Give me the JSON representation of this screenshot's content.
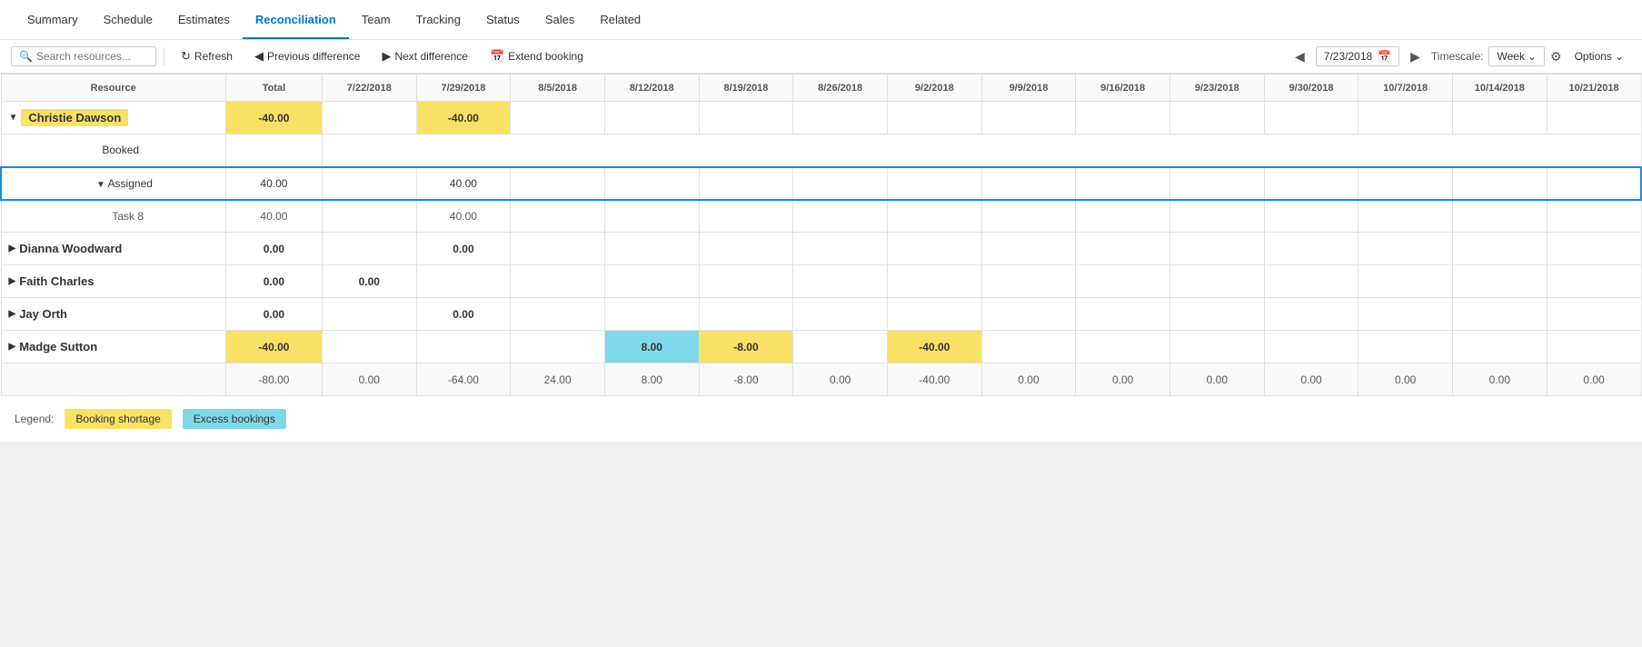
{
  "nav": {
    "items": [
      "Summary",
      "Schedule",
      "Estimates",
      "Reconciliation",
      "Team",
      "Tracking",
      "Status",
      "Sales",
      "Related"
    ],
    "active": "Reconciliation"
  },
  "toolbar": {
    "search_placeholder": "Search resources...",
    "refresh_label": "Refresh",
    "prev_diff_label": "Previous difference",
    "next_diff_label": "Next difference",
    "extend_booking_label": "Extend booking",
    "date_value": "7/23/2018",
    "timescale_label": "Timescale:",
    "timescale_value": "Week",
    "options_label": "Options"
  },
  "grid": {
    "headers": {
      "resource": "Resource",
      "total": "Total",
      "dates": [
        "7/22/2018",
        "7/29/2018",
        "8/5/2018",
        "8/12/2018",
        "8/19/2018",
        "8/26/2018",
        "9/2/2018",
        "9/9/2018",
        "9/16/2018",
        "9/23/2018",
        "9/30/2018",
        "10/7/2018",
        "10/14/2018",
        "10/21/2018"
      ]
    },
    "rows": [
      {
        "type": "resource",
        "name": "Christie Dawson",
        "highlight": true,
        "total": "-40.00",
        "cells": [
          "",
          "-40.00",
          "",
          "",
          "",
          "",
          "",
          "",
          "",
          "",
          "",
          "",
          "",
          ""
        ],
        "total_highlight": true,
        "cell_highlights": [
          false,
          true,
          false,
          false,
          false,
          false,
          false,
          false,
          false,
          false,
          false,
          false,
          false,
          false
        ]
      },
      {
        "type": "booked",
        "name": "Booked",
        "total": "",
        "cells": [
          "",
          "",
          "",
          "",
          "",
          "",
          "",
          "",
          "",
          "",
          "",
          "",
          "",
          ""
        ]
      },
      {
        "type": "assigned",
        "name": "Assigned",
        "total": "40.00",
        "cells": [
          "",
          "40.00",
          "",
          "",
          "",
          "",
          "",
          "",
          "",
          "",
          "",
          "",
          "",
          ""
        ]
      },
      {
        "type": "task",
        "name": "Task 8",
        "total": "40.00",
        "cells": [
          "",
          "40.00",
          "",
          "",
          "",
          "",
          "",
          "",
          "",
          "",
          "",
          "",
          "",
          ""
        ]
      },
      {
        "type": "resource",
        "name": "Dianna Woodward",
        "highlight": false,
        "total": "0.00",
        "cells": [
          "",
          "0.00",
          "",
          "",
          "",
          "",
          "",
          "",
          "",
          "",
          "",
          "",
          "",
          ""
        ],
        "total_highlight": false,
        "cell_highlights": []
      },
      {
        "type": "resource",
        "name": "Faith Charles",
        "highlight": false,
        "total": "0.00",
        "cells": [
          "0.00",
          "",
          "",
          "",
          "",
          "",
          "",
          "",
          "",
          "",
          "",
          "",
          "",
          ""
        ],
        "total_highlight": false,
        "cell_highlights": []
      },
      {
        "type": "resource",
        "name": "Jay Orth",
        "highlight": false,
        "total": "0.00",
        "cells": [
          "",
          "0.00",
          "",
          "",
          "",
          "",
          "",
          "",
          "",
          "",
          "",
          "",
          "",
          ""
        ],
        "total_highlight": false,
        "cell_highlights": []
      },
      {
        "type": "resource",
        "name": "Madge Sutton",
        "highlight": false,
        "total": "-40.00",
        "cells": [
          "",
          "",
          "",
          "8.00",
          "-8.00",
          "",
          "-40.00",
          "",
          "",
          "",
          "",
          "",
          "",
          ""
        ],
        "total_highlight": true,
        "cell_highlights": [
          false,
          false,
          false,
          "cyan",
          "yellow",
          false,
          "yellow",
          false,
          false,
          false,
          false,
          false,
          false,
          false
        ]
      }
    ],
    "summary_row": {
      "values": [
        "-80.00",
        "0.00",
        "-64.00",
        "24.00",
        "8.00",
        "-8.00",
        "0.00",
        "-40.00",
        "0.00",
        "0.00",
        "0.00",
        "0.00",
        "0.00",
        "0.00",
        "0.00"
      ]
    }
  },
  "legend": {
    "label": "Legend:",
    "shortage_label": "Booking shortage",
    "excess_label": "Excess bookings"
  }
}
